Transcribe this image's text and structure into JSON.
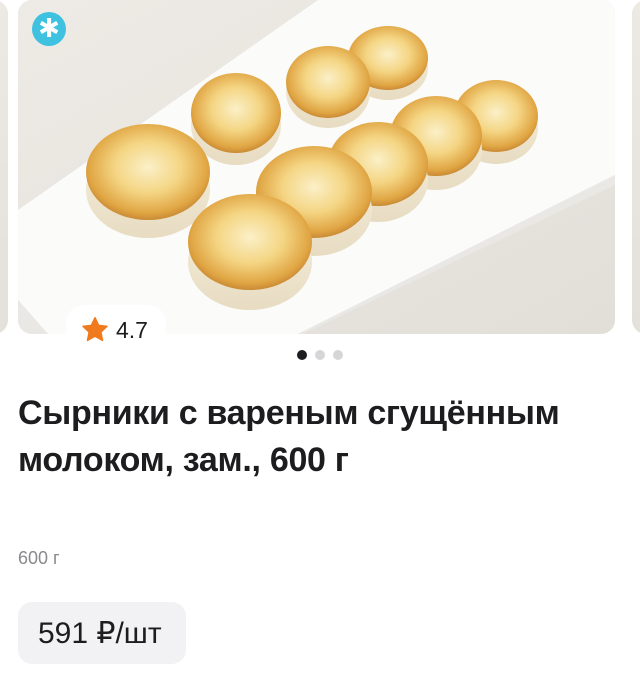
{
  "product": {
    "badge_icon": "snowflake-icon",
    "badge_symbol": "✱",
    "rating_icon": "star-icon",
    "rating": "4.7",
    "carousel": {
      "total": 3,
      "active_index": 0
    },
    "title": "Сырники с вареным сгущённым молоком, зам., 600 г",
    "weight": "600 г",
    "price": "591 ₽/шт"
  },
  "colors": {
    "badge": "#3fc1e0",
    "star": "#f07b1e",
    "text": "#1d1d1f",
    "muted": "#8a8a8e",
    "price_bg": "#f2f2f4"
  }
}
